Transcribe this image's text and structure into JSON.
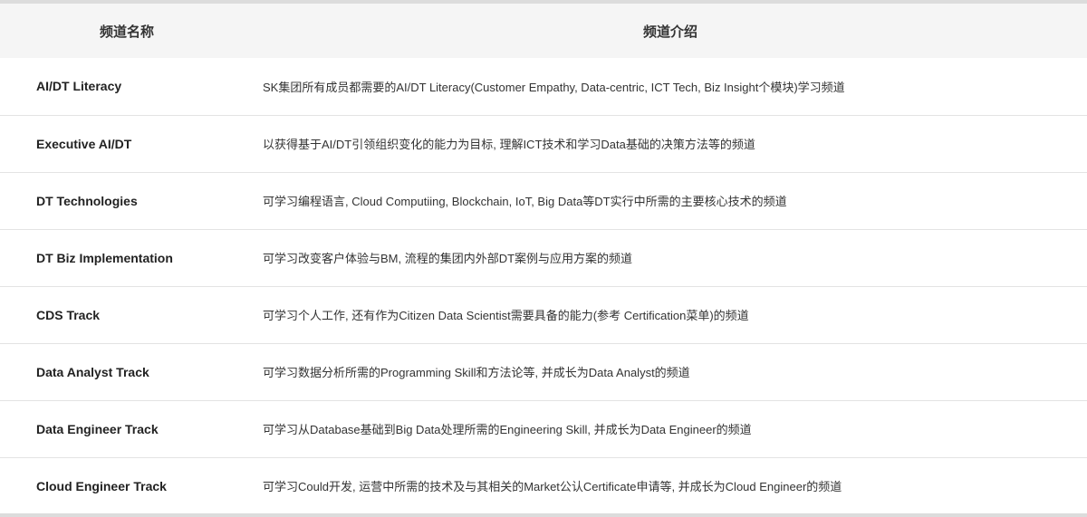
{
  "header": {
    "col_name": "频道名称",
    "col_desc": "频道介绍"
  },
  "rows": [
    {
      "name": "AI/DT Literacy",
      "desc": "SK集团所有成员都需要的AI/DT Literacy(Customer Empathy, Data-centric, ICT Tech, Biz Insight个模块)学习频道"
    },
    {
      "name": "Executive AI/DT",
      "desc": "以获得基于AI/DT引领组织变化的能力为目标, 理解ICT技术和学习Data基础的决策方法等的频道"
    },
    {
      "name": "DT Technologies",
      "desc": "可学习编程语言, Cloud Computiing, Blockchain, IoT, Big Data等DT实行中所需的主要核心技术的频道"
    },
    {
      "name": "DT Biz Implementation",
      "desc": "可学习改变客户体验与BM, 流程的集团内外部DT案例与应用方案的频道"
    },
    {
      "name": "CDS Track",
      "desc": "可学习个人工作, 还有作为Citizen Data Scientist需要具备的能力(参考 Certification菜单)的频道"
    },
    {
      "name": "Data Analyst Track",
      "desc": "可学习数据分析所需的Programming Skill和方法论等, 并成长为Data Analyst的频道"
    },
    {
      "name": "Data Engineer Track",
      "desc": "可学习从Database基础到Big Data处理所需的Engineering Skill, 并成长为Data Engineer的频道"
    },
    {
      "name": "Cloud Engineer Track",
      "desc": "可学习Could开发, 运营中所需的技术及与其相关的Market公认Certificate申请等, 并成长为Cloud Engineer的频道"
    }
  ]
}
